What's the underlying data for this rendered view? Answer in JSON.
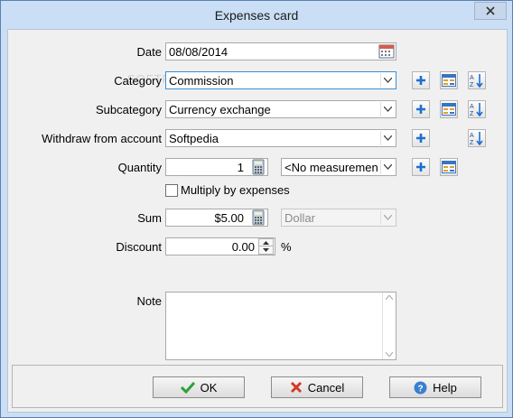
{
  "window": {
    "title": "Expenses card"
  },
  "form": {
    "date_label": "Date",
    "date_value": "08/08/2014",
    "category_label": "Category",
    "category_value": "Commission",
    "subcategory_label": "Subcategory",
    "subcategory_value": "Currency exchange",
    "withdraw_label": "Withdraw from account",
    "withdraw_value": "Softpedia",
    "quantity_label": "Quantity",
    "quantity_value": "1",
    "measurement_value": "<No measuremen",
    "multiply_label": "Multiply by expenses",
    "multiply_checked": false,
    "sum_label": "Sum",
    "sum_value": "$5.00",
    "currency_value": "Dollar",
    "discount_label": "Discount",
    "discount_value": "0.00",
    "discount_unit": "%",
    "note_label": "Note",
    "note_value": ""
  },
  "buttons": {
    "ok": "OK",
    "cancel": "Cancel",
    "help": "Help"
  },
  "watermark": "SOFTPEDIA",
  "icons": [
    "calendar-icon",
    "add-icon",
    "list-edit-icon",
    "sort-az-icon",
    "calculator-icon",
    "spin-up-icon",
    "spin-down-icon",
    "check-icon",
    "cross-icon",
    "help-icon",
    "close-icon",
    "chevron-down-icon"
  ],
  "colors": {
    "frame": "#cadff5",
    "client": "#f0f0f0",
    "add_icon": "#1e6fd0"
  }
}
